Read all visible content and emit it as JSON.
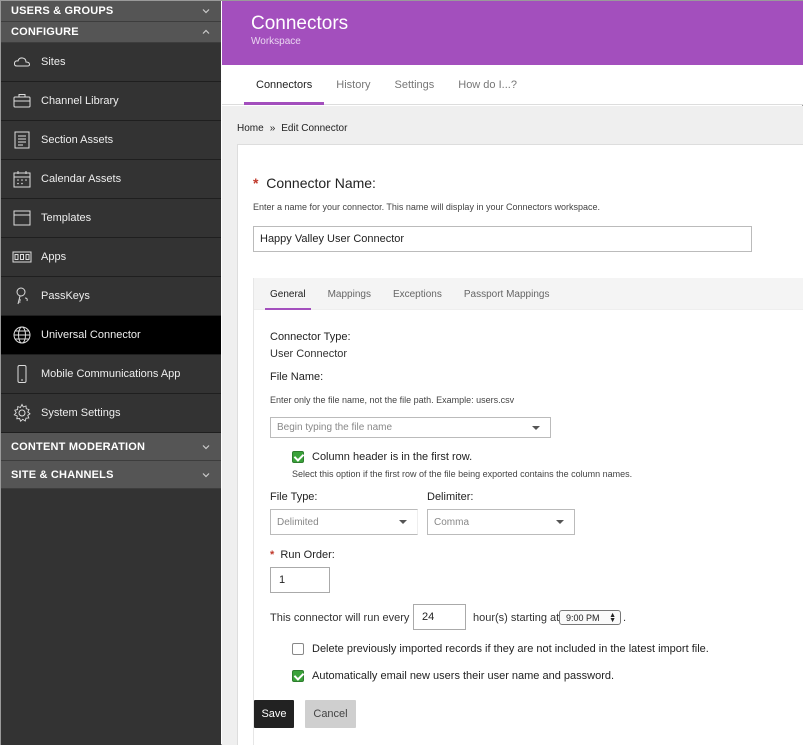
{
  "sidebar": {
    "sections": [
      {
        "label": "USERS & GROUPS"
      },
      {
        "label": "CONFIGURE"
      },
      {
        "label": "CONTENT MODERATION"
      },
      {
        "label": "SITE & CHANNELS"
      }
    ],
    "items": [
      {
        "label": "Sites",
        "icon": "cloud-icon"
      },
      {
        "label": "Channel Library",
        "icon": "briefcase-icon"
      },
      {
        "label": "Section Assets",
        "icon": "list-doc-icon"
      },
      {
        "label": "Calendar Assets",
        "icon": "calendar-icon"
      },
      {
        "label": "Templates",
        "icon": "window-icon"
      },
      {
        "label": "Apps",
        "icon": "apps-icon"
      },
      {
        "label": "PassKeys",
        "icon": "key-icon"
      },
      {
        "label": "Universal Connector",
        "icon": "globe-icon"
      },
      {
        "label": "Mobile Communications App",
        "icon": "phone-icon"
      },
      {
        "label": "System Settings",
        "icon": "gear-icon"
      }
    ]
  },
  "header": {
    "title": "Connectors",
    "subtitle": "Workspace"
  },
  "tabs": [
    "Connectors",
    "History",
    "Settings",
    "How do I...?"
  ],
  "breadcrumb": {
    "home": "Home",
    "sep": "»",
    "current": "Edit Connector"
  },
  "form": {
    "required_mark": "*",
    "name_label": "Connector Name:",
    "name_help": "Enter a name for your connector. This name will display in your Connectors workspace.",
    "name_value": "Happy Valley User Connector",
    "subtabs": [
      "General",
      "Mappings",
      "Exceptions",
      "Passport Mappings"
    ],
    "type_label": "Connector Type:",
    "type_value": "User Connector",
    "file_label": "File Name:",
    "file_help": "Enter only the file name, not the file path. Example: users.csv",
    "file_placeholder": "Begin typing the file name",
    "col_header_label": "Column header is in the first row.",
    "col_header_help": "Select this option if the first row of the file being exported contains the column names.",
    "filetype_label": "File Type:",
    "filetype_value": "Delimited",
    "delimiter_label": "Delimiter:",
    "delimiter_value": "Comma",
    "run_order_label": "Run Order:",
    "run_order_value": "1",
    "run_every_prefix": "This connector will run every",
    "run_every_value": "24",
    "run_every_suffix": "hour(s) starting at",
    "start_time": "9:00 PM",
    "period": ".",
    "delete_label": "Delete previously imported records if they are not included in the latest import file.",
    "email_label": "Automatically email new users their user name and password.",
    "save_label": "Save",
    "cancel_label": "Cancel"
  },
  "colors": {
    "accent": "#a34fbd",
    "sidebar": "#333333",
    "active": "#000000",
    "check": "#3aa23a"
  }
}
